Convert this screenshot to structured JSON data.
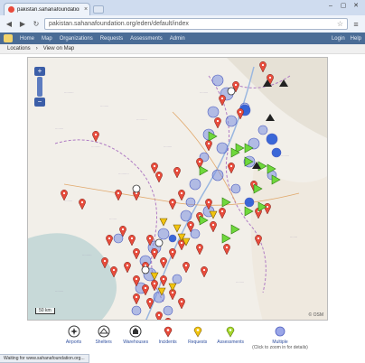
{
  "browser": {
    "tab_title": "pakistan.sahanafoundation...",
    "url": "pakistan.sahanafoundation.org/eden/default/index",
    "tab_close": "×",
    "back": "◀",
    "forward": "▶",
    "reload": "↻",
    "star": "☆",
    "wrench": "🔧",
    "win_min": "–",
    "win_max": "▢",
    "win_close": "✕"
  },
  "site": {
    "nav": [
      "Home",
      "Map",
      "Organizations",
      "Requests",
      "Assessments",
      "Admin"
    ],
    "right": [
      "Login",
      "Help"
    ],
    "breadcrumb": [
      "Locations",
      "View on Map"
    ]
  },
  "map": {
    "zoom_in": "+",
    "zoom_out": "−",
    "scale": "50 km",
    "attribution": "© OSM"
  },
  "legend": {
    "items": [
      {
        "label": "Airports",
        "icon": "airport-icon"
      },
      {
        "label": "Shelters",
        "icon": "shelter-icon"
      },
      {
        "label": "Warehouses",
        "icon": "warehouse-icon"
      },
      {
        "label": "Incidents",
        "icon": "incident-pin-icon",
        "color": "#e74c3c"
      },
      {
        "label": "Requests",
        "icon": "request-pin-icon",
        "color": "#f1c40f"
      },
      {
        "label": "Assessments",
        "icon": "assessment-pin-icon",
        "color": "#a6d82b"
      },
      {
        "label": "Multiple",
        "sub": "(Click to zoom in for details)",
        "icon": "cluster-icon",
        "color": "#6b7bd6"
      }
    ]
  },
  "status": "Waiting for www.sahanafoundation.org...",
  "colors": {
    "incident": "#e74c3c",
    "request": "#f1c40f",
    "assessment": "#6fd83c",
    "cluster": "#7b8fe0",
    "cluster_solid": "#2f5fd6"
  }
}
